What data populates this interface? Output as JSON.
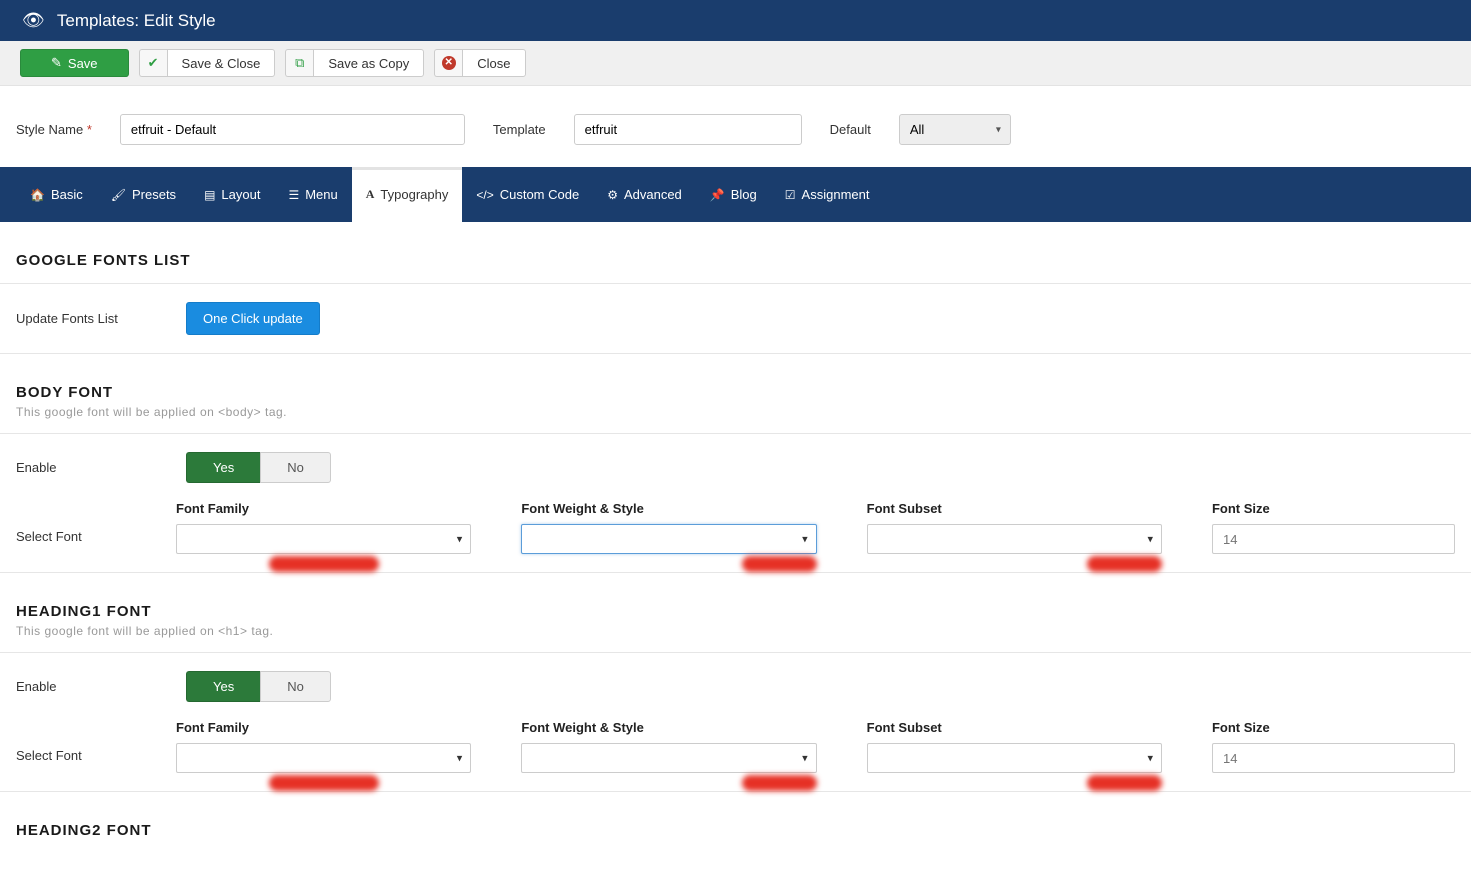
{
  "header": {
    "title": "Templates: Edit Style"
  },
  "toolbar": {
    "save": "Save",
    "save_close": "Save & Close",
    "save_copy": "Save as Copy",
    "close": "Close"
  },
  "form": {
    "style_name_label": "Style Name",
    "style_name_value": "etfruit - Default",
    "template_label": "Template",
    "template_value": "etfruit",
    "default_label": "Default",
    "default_value": "All"
  },
  "tabs": {
    "basic": "Basic",
    "presets": "Presets",
    "layout": "Layout",
    "menu": "Menu",
    "typography": "Typography",
    "custom_code": "Custom Code",
    "advanced": "Advanced",
    "blog": "Blog",
    "assignment": "Assignment"
  },
  "sections": {
    "google_fonts_title": "GOOGLE FONTS LIST",
    "update_fonts_label": "Update Fonts List",
    "oneclick": "One Click update",
    "body_font_title": "BODY FONT",
    "body_font_sub": "This google font will be applied on <body> tag.",
    "h1_title": "HEADING1 FONT",
    "h1_sub": "This google font will be applied on <h1> tag.",
    "h2_title": "HEADING2 FONT",
    "enable_label": "Enable",
    "yes": "Yes",
    "no": "No",
    "select_font_label": "Select Font",
    "font_family": "Font Family",
    "font_weight": "Font Weight & Style",
    "font_subset": "Font Subset",
    "font_size": "Font Size",
    "font_size_placeholder": "14"
  }
}
